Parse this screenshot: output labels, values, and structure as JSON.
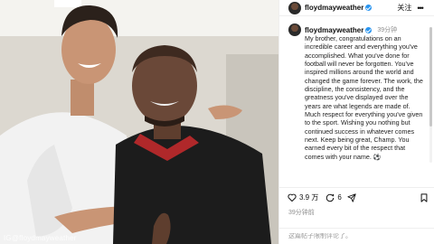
{
  "post": {
    "username": "floydmayweather",
    "follow_label": "关注",
    "caption_time": "39分钟",
    "caption": "My brother, congratulations on an incredible career and everything you've accomplished. What you've done for football will never be forgotten. You've inspired millions around the world and changed the game forever. The work, the discipline, the consistency, and the greatness you've displayed over the years are what legends are made of. Much respect for everything you've given to the sport. Wishing you nothing but continued success in whatever comes next. Keep being great, Champ. You earned every bit of the respect that comes with your name.",
    "caption_emoji": "⚽",
    "likes": "3.9 万",
    "comments": "6",
    "post_time": "39分钟前",
    "comment_placeholder": "这篇帖子限制评论了。"
  },
  "photo": {
    "credit": "IG@floydmayweather"
  },
  "icons": {
    "verified": "verified-badge",
    "more": "more-icon",
    "like": "heart-icon",
    "comment": "comment-icon",
    "share": "send-icon",
    "save": "bookmark-icon"
  },
  "colors": {
    "verified_blue": "#2a95f0",
    "muted_text": "#8e8e8e",
    "shirt_black": "#1c1c1c",
    "collar_red": "#b0282a"
  }
}
